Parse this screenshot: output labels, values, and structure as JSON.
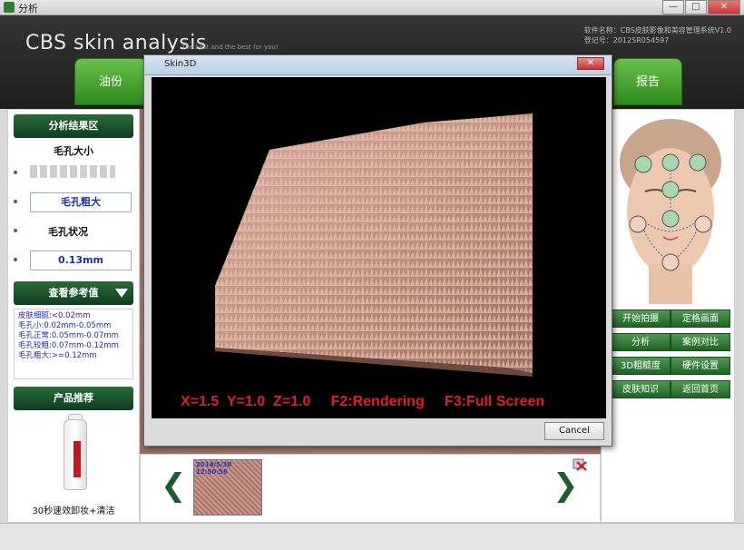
{
  "window": {
    "title": "分析",
    "minimize": "—",
    "maximize": "□",
    "close": "✕"
  },
  "header": {
    "brand": "CBS skin analysis",
    "slogan": "The best and the best for you!",
    "software_name": "软件名称：CBS皮肤影像和美容管理系统V1.0",
    "registration": "登记号：2012SR054597"
  },
  "nav": {
    "oil_tab": "油份",
    "report_tab": "报告"
  },
  "left_panel": {
    "result_area_title": "分析结果区",
    "pore_size_title": "毛孔大小",
    "pore_size_value": "毛孔粗大",
    "pore_condition_label": "毛孔状况",
    "pore_measure": "0.13mm",
    "reference_title": "查看参考值",
    "reference_items": [
      "皮肤细腻:<0.02mm",
      "毛孔小:0.02mm-0.05mm",
      "毛孔正常:0.05mm-0.07mm",
      "毛孔较粗:0.07mm-0.12mm",
      "毛孔粗大:>=0.12mm"
    ],
    "product_title": "产品推荐",
    "product_caption": "30秒速效卸妆+清洁"
  },
  "thumbnails": [
    {
      "timestamp": "2014/5/30 12:50:56"
    }
  ],
  "right_panel": {
    "buttons": [
      "开始拍摄",
      "定格画面",
      "分析",
      "案例对比",
      "3D粗糙度",
      "硬件设置",
      "皮肤知识",
      "返回首页"
    ]
  },
  "modal": {
    "title": "Skin3D",
    "close": "✕",
    "readout": "X=1.5  Y=1.0  Z=1.0     F2:Rendering     F3:Full Screen",
    "cancel": "Cancel"
  },
  "colors": {
    "accent_green": "#2d8a1e",
    "readout_red": "#e02020",
    "value_blue": "#1b2fa8"
  }
}
